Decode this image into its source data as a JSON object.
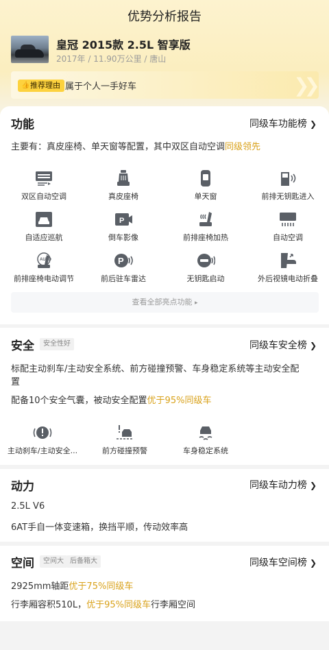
{
  "page": {
    "title": "优势分析报告"
  },
  "car": {
    "name": "皇冠 2015款 2.5L 智享版",
    "meta": "2017年 / 11.90万公里 / 唐山"
  },
  "reason": {
    "tag": "推荐理由",
    "text": "属于个人一手好车"
  },
  "features": {
    "title": "功能",
    "link": "同级车功能榜",
    "summary_prefix": "主要有：真皮座椅、单天窗等配置，其中双区自动空调",
    "summary_highlight": "同级领先",
    "items": [
      {
        "label": "双区自动空调",
        "icon": "ac-vent-icon"
      },
      {
        "label": "真皮座椅",
        "icon": "seat-icon"
      },
      {
        "label": "单天窗",
        "icon": "sunroof-icon"
      },
      {
        "label": "前排无钥匙进入",
        "icon": "keyless-entry-icon"
      },
      {
        "label": "自适应巡航",
        "icon": "adaptive-cruise-icon"
      },
      {
        "label": "倒车影像",
        "icon": "reverse-camera-icon"
      },
      {
        "label": "前排座椅加热",
        "icon": "seat-heating-icon"
      },
      {
        "label": "自动空调",
        "icon": "auto-ac-icon"
      },
      {
        "label": "前排座椅电动调节",
        "icon": "power-seat-icon"
      },
      {
        "label": "前后驻车雷达",
        "icon": "parking-radar-icon"
      },
      {
        "label": "无钥匙启动",
        "icon": "push-start-icon"
      },
      {
        "label": "外后视镜电动折叠",
        "icon": "mirror-fold-icon"
      }
    ],
    "view_all": "查看全部亮点功能"
  },
  "safety": {
    "title": "安全",
    "tag": "安全性好",
    "link": "同级车安全榜",
    "line1a": "标配主动刹车/主动安全系统、前方碰撞预警、车身稳定系统等主动安全配",
    "line1b": "置",
    "line2_prefix": "配备10个安全气囊，被动安全配置",
    "line2_highlight": "优于95%同级车",
    "items": [
      {
        "label": "主动刹车/主动安全...",
        "icon": "brake-warning-icon"
      },
      {
        "label": "前方碰撞预警",
        "icon": "collision-warning-icon"
      },
      {
        "label": "车身稳定系统",
        "icon": "stability-control-icon"
      }
    ]
  },
  "power": {
    "title": "动力",
    "link": "同级车动力榜",
    "line1": "2.5L V6",
    "line2": "6AT手自一体变速箱，换挡平顺，传动效率高"
  },
  "space": {
    "title": "空间",
    "tags": [
      "空间大",
      "后备箱大"
    ],
    "link": "同级车空间榜",
    "line1_prefix": "2925mm轴距",
    "line1_highlight": "优于75%同级车",
    "line2_prefix": "行李厢容积510L，",
    "line2_highlight": "优于95%同级车",
    "line2_suffix": "行李厢空间"
  },
  "colors": {
    "highlight": "#d9a21b",
    "tag_yellow": "#fdd23e",
    "header_bg": "#fbeebf"
  }
}
